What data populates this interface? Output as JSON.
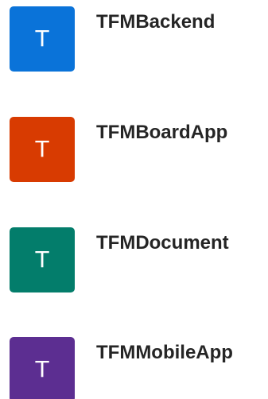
{
  "projects": [
    {
      "initial": "T",
      "name": "TFMBackend",
      "color": "#0a73d9"
    },
    {
      "initial": "T",
      "name": "TFMBoardApp",
      "color": "#d83b01"
    },
    {
      "initial": "T",
      "name": "TFMDocument",
      "color": "#037d6b"
    },
    {
      "initial": "T",
      "name": "TFMMobileApp",
      "color": "#5c2e91"
    }
  ]
}
